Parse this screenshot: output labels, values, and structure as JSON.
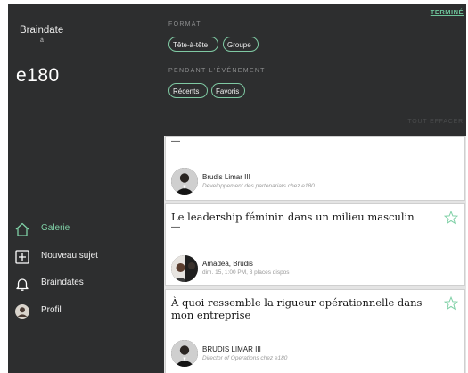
{
  "sidebar": {
    "brand_title": "Braindate",
    "brand_sub": "à",
    "logo_text": "e180",
    "nav": [
      {
        "label": "Galerie",
        "icon": "home-icon",
        "active": true
      },
      {
        "label": "Nouveau sujet",
        "icon": "plus-square-icon",
        "active": false
      },
      {
        "label": "Braindates",
        "icon": "bell-icon",
        "active": false
      },
      {
        "label": "Profil",
        "icon": "avatar-icon",
        "active": false
      }
    ]
  },
  "filters": {
    "done_label": "TERMINÉ",
    "format_title": "FORMAT",
    "format_chips": [
      "Tête-à-tête",
      "Groupe"
    ],
    "event_title": "PENDANT L'ÉVÉNEMENT",
    "event_chips": [
      "Récents",
      "Favoris"
    ],
    "clear_all": "TOUT EFFACER"
  },
  "cards": [
    {
      "title": "",
      "name": "Brudis Limar III",
      "info": "Développement des partenariats chez e180",
      "info_italic": true
    },
    {
      "title": "Le leadership féminin dans un milieu masculin",
      "name": "Amadea, Brudis",
      "info": "dim. 15, 1:00 PM, 3 places dispos",
      "info_italic": false
    },
    {
      "title": "À quoi ressemble la rigueur opérationnelle dans mon entreprise",
      "name": "BRUDIS LIMAR III",
      "info": "Director of Operations chez e180",
      "info_italic": true
    }
  ],
  "dash": "—",
  "colors": {
    "sidebar_bg": "#2d2e2f",
    "accent": "#7fd0a6",
    "chip_border": "#7fc9a3"
  }
}
